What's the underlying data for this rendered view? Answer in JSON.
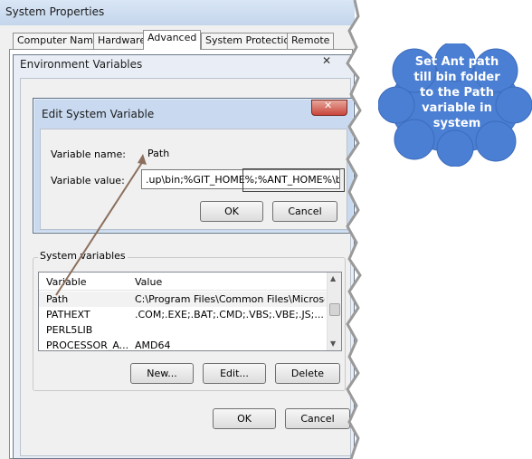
{
  "system_properties": {
    "title": "System Properties",
    "tabs": [
      {
        "label": "Computer Name"
      },
      {
        "label": "Hardware"
      },
      {
        "label": "Advanced"
      },
      {
        "label": "System Protection"
      },
      {
        "label": "Remote"
      }
    ],
    "active_tab": "Advanced",
    "ok_label": "OK",
    "cancel_label": "Cancel"
  },
  "env_vars": {
    "title": "Environment Variables",
    "system_variables_label": "System variables",
    "columns": {
      "variable": "Variable",
      "value": "Value"
    },
    "rows": [
      {
        "variable": "Path",
        "value": "C:\\Program Files\\Common Files\\Microsof..."
      },
      {
        "variable": "PATHEXT",
        "value": ".COM;.EXE;.BAT;.CMD;.VBS;.VBE;.JS;...."
      },
      {
        "variable": "PERL5LIB",
        "value": ""
      },
      {
        "variable": "PROCESSOR_A...",
        "value": "AMD64"
      }
    ],
    "buttons": {
      "new": "New...",
      "edit": "Edit...",
      "delete": "Delete"
    }
  },
  "edit_dialog": {
    "title": "Edit System Variable",
    "variable_name_label": "Variable name:",
    "variable_name": "Path",
    "variable_value_label": "Variable value:",
    "variable_value": ".up\\bin;%GIT_HOME%;%ANT_HOME%\\bin",
    "ok_label": "OK",
    "cancel_label": "Cancel"
  },
  "callout": {
    "text_lines": [
      "Set Ant path",
      "till bin folder",
      "to the Path",
      "variable in",
      "system"
    ],
    "color": "#4a7fd4"
  }
}
